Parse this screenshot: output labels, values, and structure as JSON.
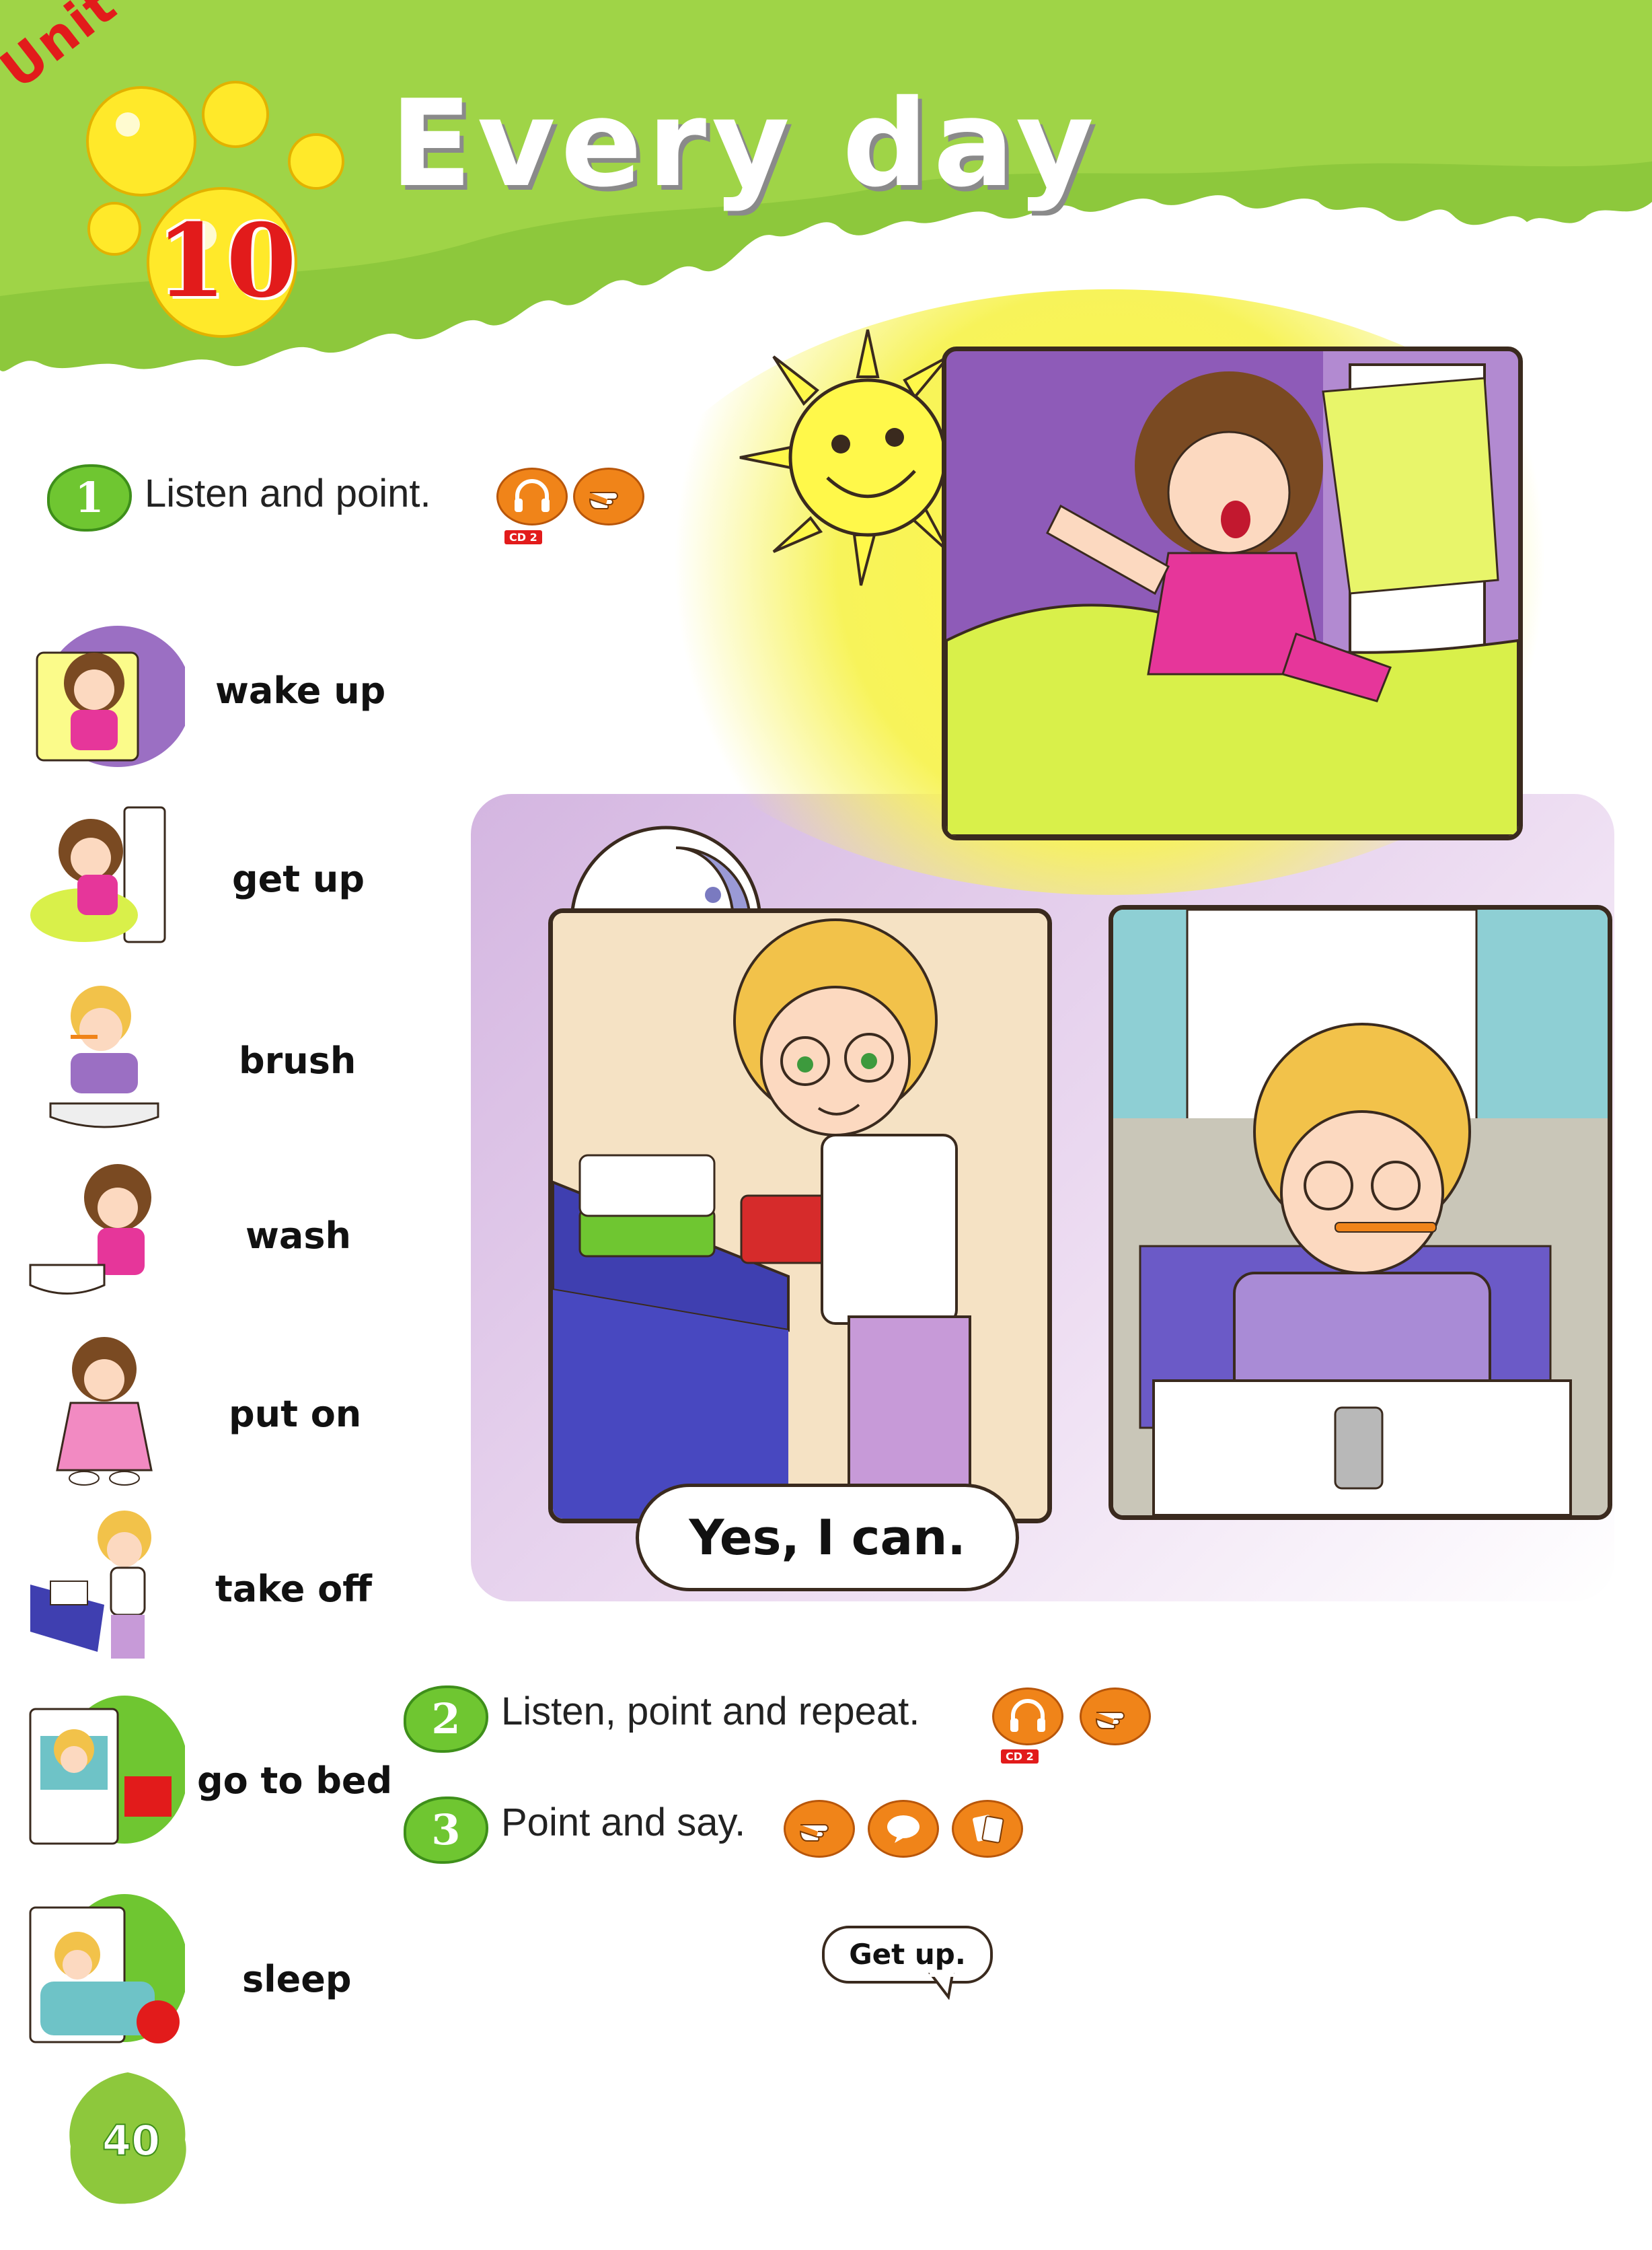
{
  "header": {
    "unit_label": "Unit",
    "unit_number": "10",
    "title": "Every day"
  },
  "activity1": {
    "number": "1",
    "instruction": "Listen and point.",
    "cd_label": "CD 2",
    "icons": [
      "headphones-icon",
      "pointing-hand-icon"
    ]
  },
  "vocabulary": [
    {
      "word": "wake up"
    },
    {
      "word": "get up"
    },
    {
      "word": "brush"
    },
    {
      "word": "wash"
    },
    {
      "word": "put on"
    },
    {
      "word": "take off"
    },
    {
      "word": "go to bed"
    },
    {
      "word": "sleep"
    }
  ],
  "scene": {
    "speech_bubble": "Yes, I can."
  },
  "activity2": {
    "number": "2",
    "instruction": "Listen, point and repeat.",
    "cd_label": "CD 2",
    "icons": [
      "headphones-icon",
      "pointing-hand-icon"
    ]
  },
  "activity3": {
    "number": "3",
    "instruction": "Point and say.",
    "icons": [
      "pointing-hand-icon",
      "speech-bubble-icon",
      "cards-icon"
    ]
  },
  "example_bubble": "Get up.",
  "page_number": "40",
  "colors": {
    "header_green": "#8dc83c",
    "badge_green": "#6fc631",
    "icon_orange": "#f08419",
    "unit_red": "#e21b1b",
    "sun_yellow": "#fff84a",
    "bg_purple": "#c9a3d9"
  }
}
